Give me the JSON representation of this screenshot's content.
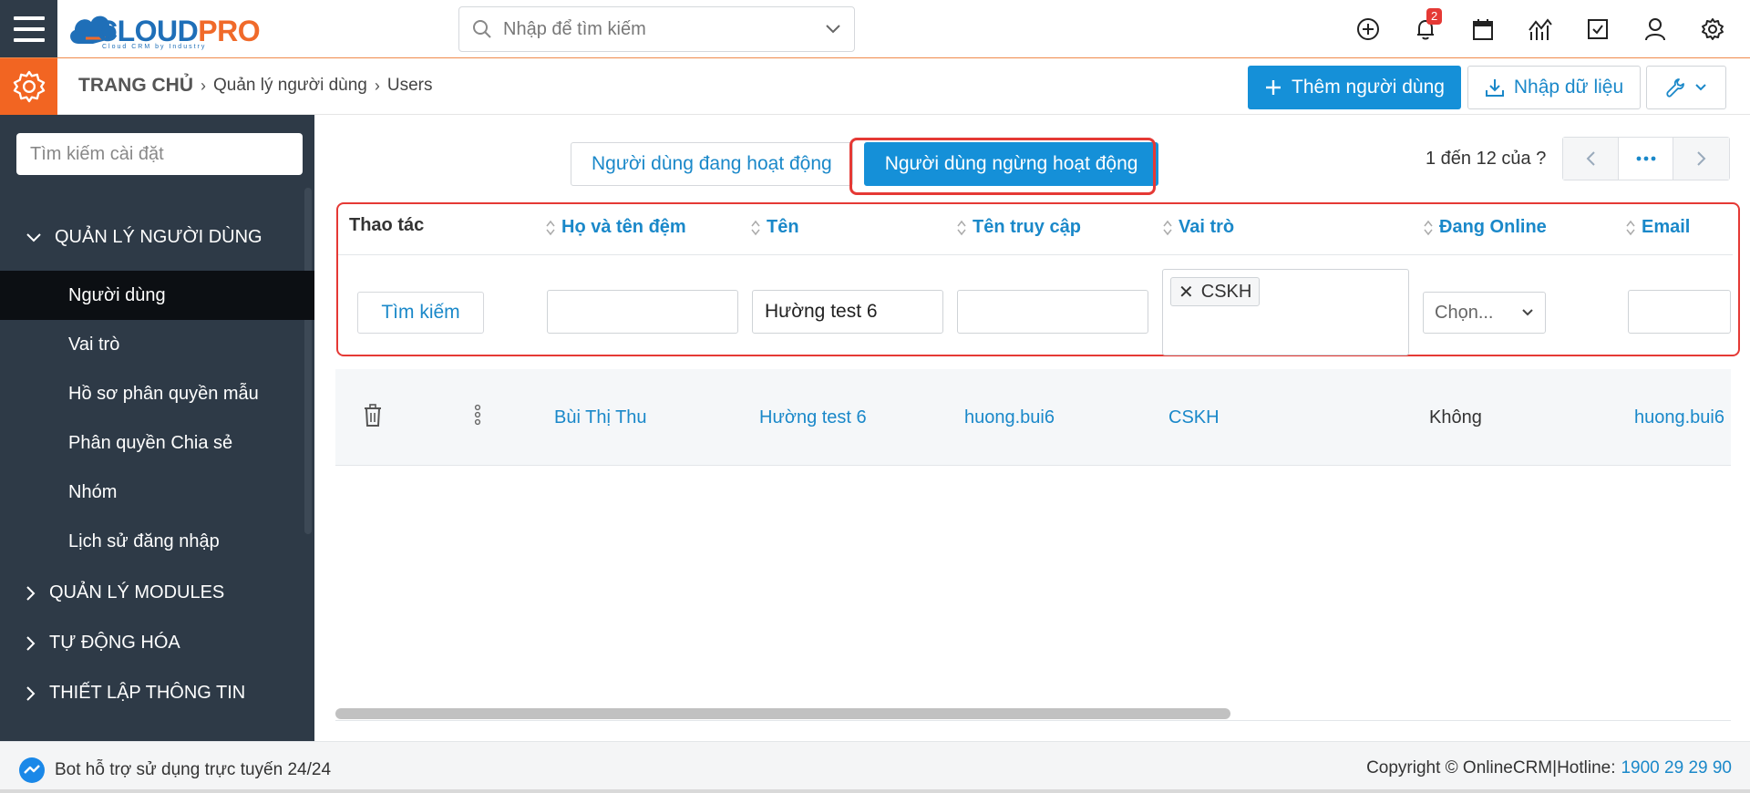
{
  "brand": {
    "logo_main": "CLOUD",
    "logo_accent": "PRO",
    "logo_sub": "Cloud CRM by Industry"
  },
  "topbar": {
    "search_placeholder": "Nhập để tìm kiếm",
    "notification_count": "2",
    "icons": [
      "plus-circle-icon",
      "bell-icon",
      "calendar-icon",
      "chart-icon",
      "checkbox-icon",
      "user-icon",
      "gear-icon"
    ]
  },
  "breadcrumb": {
    "home": "TRANG CHỦ",
    "section": "Quản lý người dùng",
    "page": "Users"
  },
  "actions": {
    "add_user": "Thêm người dùng",
    "import": "Nhập dữ liệu"
  },
  "sidebar": {
    "search_placeholder": "Tìm kiếm cài đặt",
    "groups": [
      {
        "label": "QUẢN LÝ NGƯỜI DÙNG",
        "expanded": true
      },
      {
        "label": "QUẢN LÝ MODULES"
      },
      {
        "label": "TỰ ĐỘNG HÓA"
      },
      {
        "label": "THIẾT LẬP THÔNG TIN"
      }
    ],
    "items": [
      "Người dùng",
      "Vai trò",
      "Hồ sơ phân quyền mẫu",
      "Phân quyền Chia sẻ",
      "Nhóm",
      "Lịch sử đăng nhập"
    ],
    "active_item": "Người dùng"
  },
  "tabs": {
    "active_users": "Người dùng đang hoạt động",
    "inactive_users": "Người dùng ngừng hoạt động",
    "selected": "inactive_users"
  },
  "pager": {
    "range": "1 đến 12 của",
    "unknown": "?",
    "more": "···"
  },
  "table": {
    "headers": {
      "actions": "Thao tác",
      "middle_name": "Họ và tên đệm",
      "first_name": "Tên",
      "username": "Tên truy cập",
      "role": "Vai trò",
      "online": "Đang Online",
      "email": "Email"
    },
    "filters": {
      "search_button": "Tìm kiếm",
      "middle_name": "",
      "first_name": "Hường test 6",
      "username": "",
      "role_chip": "CSKH",
      "online_placeholder": "Chọn...",
      "email": ""
    },
    "rows": [
      {
        "middle_name": "Bùi Thị Thu",
        "first_name": "Hường test 6",
        "username": "huong.bui6",
        "role": "CSKH",
        "online": "Không",
        "email": "huong.bui6"
      }
    ]
  },
  "footer": {
    "bot": "Bot hỗ trợ sử dụng trực tuyến 24/24",
    "copyright": "Copyright © OnlineCRM|Hotline: ",
    "hotline": "1900 29 29 90"
  },
  "colors": {
    "brand_blue": "#1590d8",
    "accent_orange": "#f26522",
    "sidebar_bg": "#2e3a47",
    "highlight_red": "#e53935"
  }
}
